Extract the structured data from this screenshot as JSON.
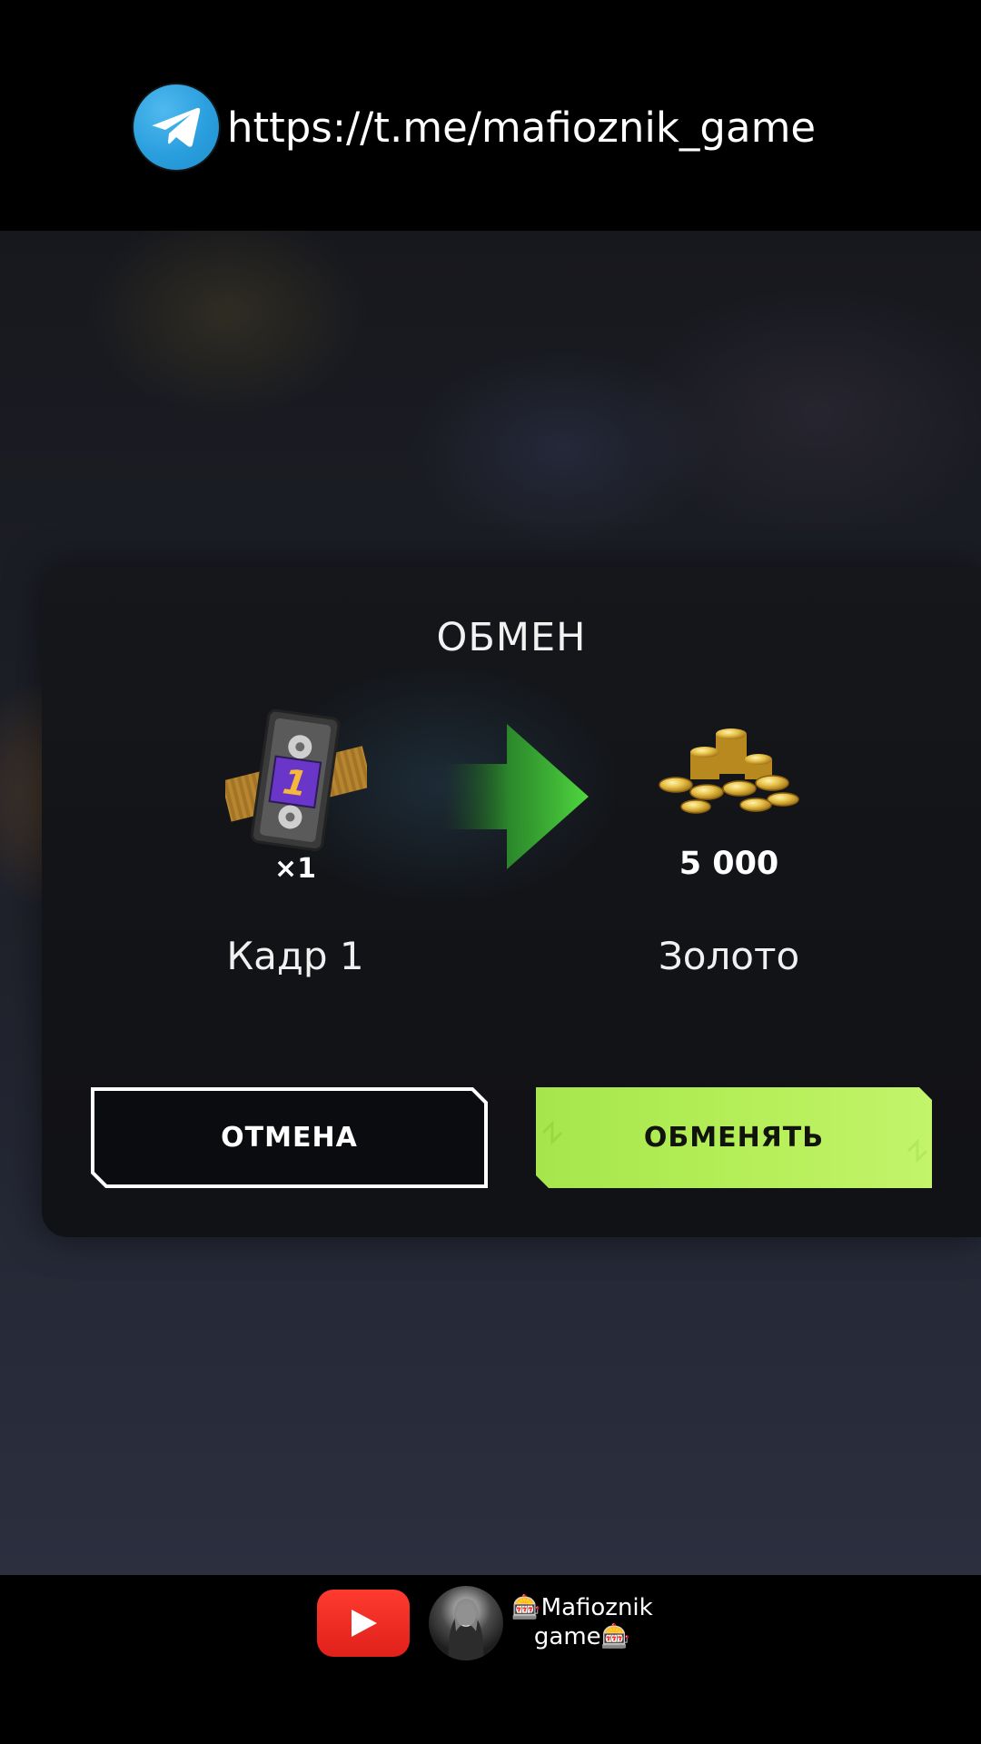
{
  "top_banner": {
    "link": "https://t.me/mafioznik_game",
    "icon": "telegram-icon"
  },
  "dialog": {
    "title": "ОБМЕН",
    "give": {
      "icon": "film-cassette-icon",
      "badge": "1",
      "quantity": "×1",
      "name": "Кадр 1"
    },
    "arrow_icon": "arrow-right-icon",
    "get": {
      "icon": "gold-coins-icon",
      "amount": "5 000",
      "name": "Золото"
    },
    "cancel_label": "ОТМЕНА",
    "exchange_label": "ОБМЕНЯТЬ",
    "colors": {
      "exchange_button": "#b8ef5a",
      "arrow": "#3fbf3a",
      "badge": "#6a36c9",
      "badge_digit": "#f5b83a"
    }
  },
  "bottom_banner": {
    "icon": "youtube-icon",
    "avatar": "channel-avatar",
    "channel_name": "🎰Mafioznik\ngame🎰"
  }
}
